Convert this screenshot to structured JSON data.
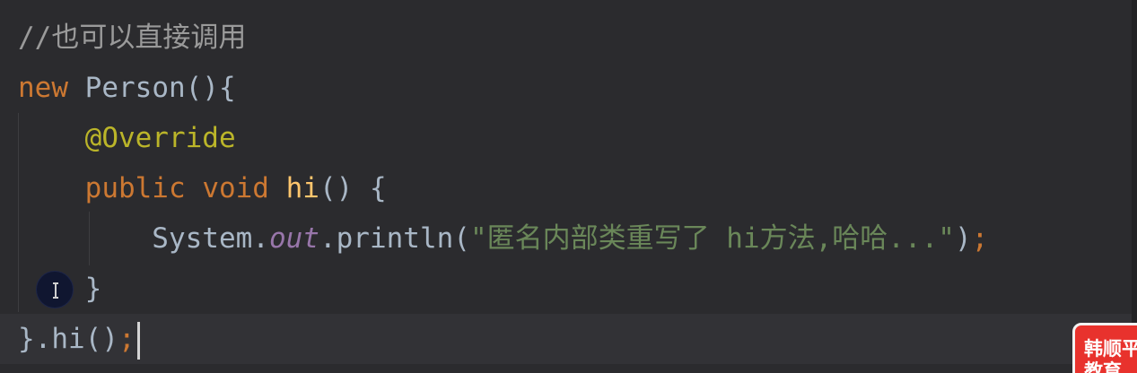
{
  "editor": {
    "lines": [
      {
        "tokens": [
          {
            "text": "//也可以直接调用",
            "kind": "comment"
          }
        ]
      },
      {
        "tokens": [
          {
            "text": "new",
            "kind": "keyword"
          },
          {
            "text": " Person(){",
            "kind": "plain"
          }
        ]
      },
      {
        "tokens": [
          {
            "text": "    ",
            "kind": "plain"
          },
          {
            "text": "@Override",
            "kind": "annotation"
          }
        ]
      },
      {
        "tokens": [
          {
            "text": "    ",
            "kind": "plain"
          },
          {
            "text": "public",
            "kind": "keyword"
          },
          {
            "text": " ",
            "kind": "plain"
          },
          {
            "text": "void",
            "kind": "keyword"
          },
          {
            "text": " ",
            "kind": "plain"
          },
          {
            "text": "hi",
            "kind": "method"
          },
          {
            "text": "() {",
            "kind": "plain"
          }
        ]
      },
      {
        "tokens": [
          {
            "text": "        System.",
            "kind": "plain"
          },
          {
            "text": "out",
            "kind": "field"
          },
          {
            "text": ".println(",
            "kind": "plain"
          },
          {
            "text": "\"匿名内部类重写了 hi方法,哈哈...\"",
            "kind": "string"
          },
          {
            "text": ")",
            "kind": "plain"
          },
          {
            "text": ";",
            "kind": "keyword"
          }
        ]
      },
      {
        "tokens": [
          {
            "text": "    }",
            "kind": "plain"
          }
        ]
      },
      {
        "tokens": [
          {
            "text": "}.hi()",
            "kind": "plain"
          },
          {
            "text": ";",
            "kind": "keyword"
          }
        ],
        "current": true
      }
    ]
  },
  "icons": {
    "cursor": "text-cursor-ibeam-icon"
  },
  "watermark": {
    "line1": "韩顺平",
    "line2": "教育"
  },
  "colors": {
    "background": "#2b2b2e",
    "comment": "#9a9a9a",
    "keyword": "#cc7832",
    "plain": "#a9b7c6",
    "annotation": "#bbb529",
    "method": "#ffc66d",
    "field": "#9876aa",
    "string": "#6a8759",
    "watermark": "#e8322d"
  }
}
